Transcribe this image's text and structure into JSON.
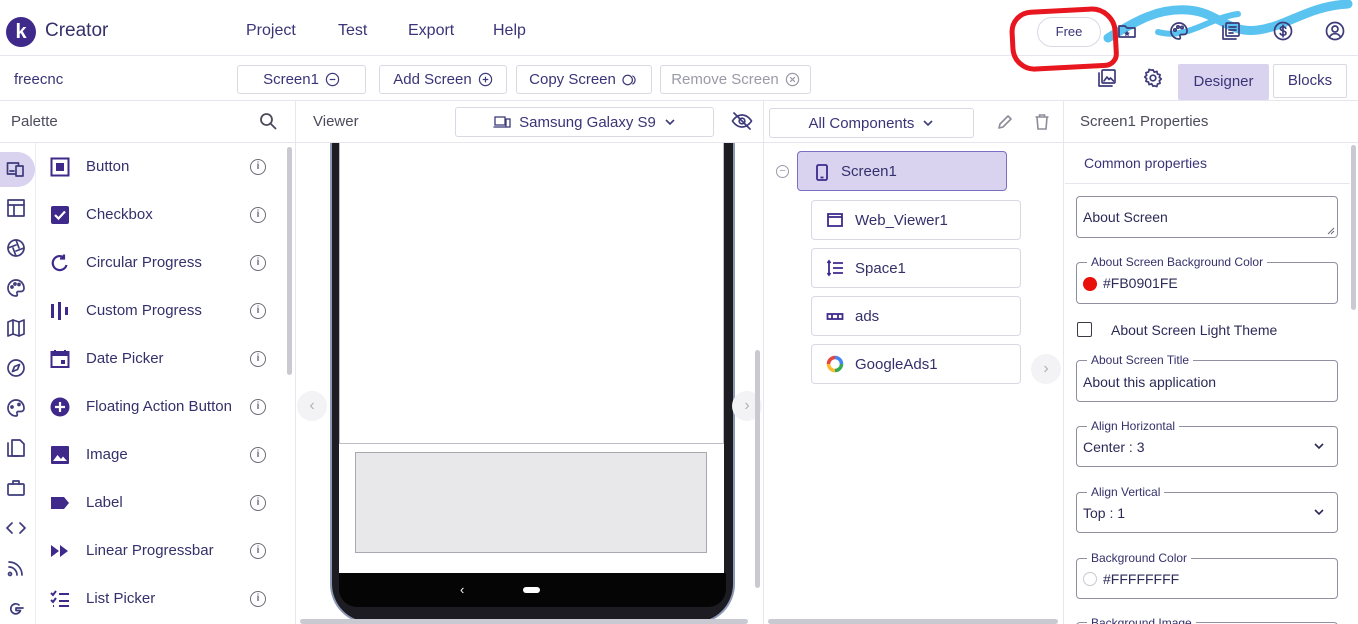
{
  "app": {
    "logo_letter": "k",
    "title": "Creator"
  },
  "menu": [
    "Project",
    "Test",
    "Export",
    "Help"
  ],
  "top_right": {
    "plan_label": "Free",
    "icons": [
      "folder-star-icon",
      "palette-icon",
      "docs-icon",
      "dollar-icon",
      "account-icon"
    ]
  },
  "toolbar": {
    "project_name": "freecnc",
    "screen_select": "Screen1",
    "add_screen": "Add Screen",
    "copy_screen": "Copy Screen",
    "remove_screen": "Remove Screen",
    "designer": "Designer",
    "blocks": "Blocks"
  },
  "palette": {
    "title": "Palette",
    "info_glyph": "i",
    "items": [
      {
        "label": "Button",
        "icon": "button-icon"
      },
      {
        "label": "Checkbox",
        "icon": "checkbox-icon"
      },
      {
        "label": "Circular Progress",
        "icon": "circular-progress-icon"
      },
      {
        "label": "Custom Progress",
        "icon": "custom-progress-icon"
      },
      {
        "label": "Date Picker",
        "icon": "date-picker-icon"
      },
      {
        "label": "Floating Action Button",
        "icon": "fab-icon"
      },
      {
        "label": "Image",
        "icon": "image-icon"
      },
      {
        "label": "Label",
        "icon": "label-icon"
      },
      {
        "label": "Linear Progressbar",
        "icon": "linear-progress-icon"
      },
      {
        "label": "List Picker",
        "icon": "list-picker-icon"
      }
    ]
  },
  "viewer": {
    "title": "Viewer",
    "device": "Samsung Galaxy S9",
    "nav_back": "‹",
    "nav_prev": "‹",
    "nav_next": "›"
  },
  "components": {
    "filter": "All Components",
    "collapse_glyph": "−",
    "nav_next": "›",
    "root": "Screen1",
    "children": [
      {
        "label": "Web_Viewer1",
        "icon": "web-viewer-icon"
      },
      {
        "label": "Space1",
        "icon": "space-icon"
      },
      {
        "label": "ads",
        "icon": "ads-icon"
      },
      {
        "label": "GoogleAds1",
        "icon": "google-ads-icon"
      }
    ]
  },
  "properties": {
    "title": "Screen1 Properties",
    "section": "Common properties",
    "about_screen": "About Screen",
    "bg_color_label": "About Screen Background Color",
    "bg_color_value": "#FB0901FE",
    "bg_color_swatch": "#e8100b",
    "light_theme_label": "About Screen Light Theme",
    "title_label": "About Screen Title",
    "title_value": "About this application",
    "align_h_label": "Align Horizontal",
    "align_h_value": "Center : 3",
    "align_v_label": "Align Vertical",
    "align_v_value": "Top : 1",
    "background_color_label": "Background Color",
    "background_color_value": "#FFFFFFFF",
    "background_image_label": "Background Image"
  },
  "colors": {
    "accent": "#3f2a8c",
    "selected": "#d9d3f0",
    "annotation_red": "#e8161f",
    "annotation_blue": "#5bc3f0"
  }
}
